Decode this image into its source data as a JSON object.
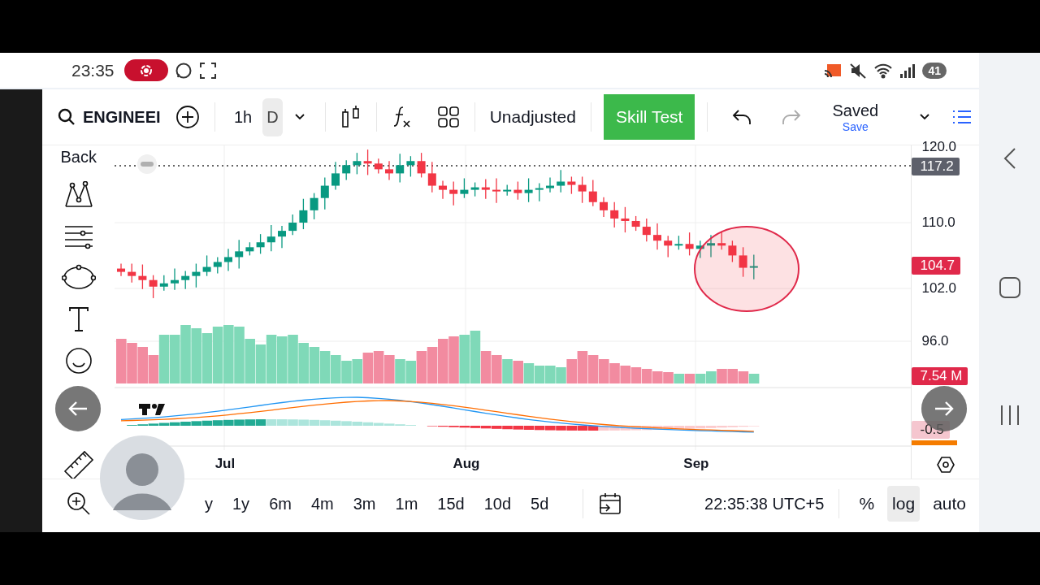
{
  "status_bar": {
    "time": "23:35",
    "battery": "41"
  },
  "toolbar": {
    "symbol": "ENGINEEI",
    "intervals": [
      {
        "label": "1h",
        "selected": false
      },
      {
        "label": "D",
        "selected": true
      }
    ],
    "adjustment": "Unadjusted",
    "skill_test": "Skill Test",
    "undo": {
      "disabled": false
    },
    "redo": {
      "disabled": true
    },
    "saved": "Saved",
    "save": "Save"
  },
  "left_tools": {
    "back": "Back"
  },
  "price_axis": {
    "labels": [
      {
        "text": "120.0",
        "kind": "tick"
      },
      {
        "text": "117.2",
        "kind": "badge",
        "color": "#5d606b"
      },
      {
        "text": "110.0",
        "kind": "tick"
      },
      {
        "text": "104.7",
        "kind": "badge",
        "color": "#e0294a"
      },
      {
        "text": "102.0",
        "kind": "tick"
      },
      {
        "text": "96.0",
        "kind": "tick"
      },
      {
        "text": "7.54 M",
        "kind": "badge",
        "color": "#e0294a"
      },
      {
        "text": "-0.5",
        "kind": "badge",
        "color": "#f5c6cf"
      }
    ]
  },
  "time_axis": [
    "Jul",
    "Aug",
    "Sep"
  ],
  "bottom_bar": {
    "ranges": [
      "y",
      "1y",
      "6m",
      "4m",
      "3m",
      "1m",
      "15d",
      "10d",
      "5d"
    ],
    "clock": "22:35:38 UTC+5",
    "scale_options": [
      {
        "label": "%",
        "selected": false
      },
      {
        "label": "log",
        "selected": true
      },
      {
        "label": "auto",
        "selected": false
      }
    ]
  }
}
